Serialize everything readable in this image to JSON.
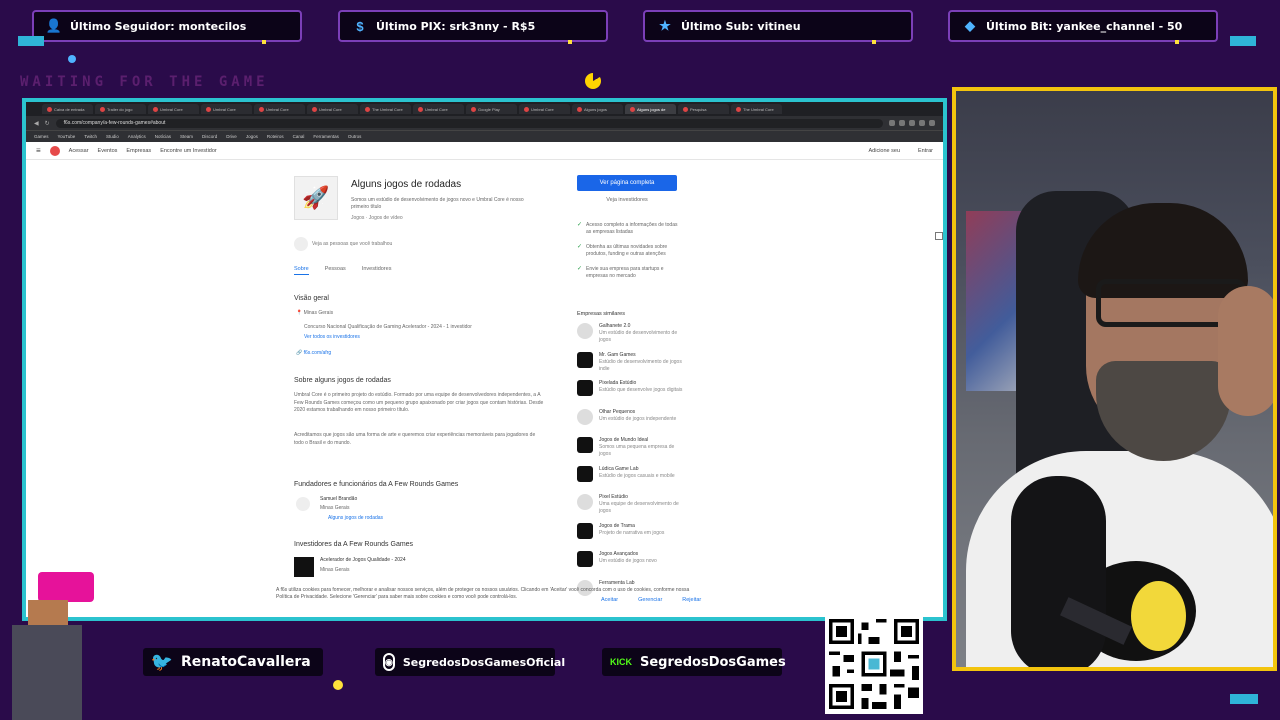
{
  "alerts": [
    {
      "icon": "user-icon",
      "label": "Último Seguidor: montecilos"
    },
    {
      "icon": "dollar-icon",
      "label": "Último PIX: srk3nny - R$5"
    },
    {
      "icon": "star-icon",
      "label": "Último Sub: vitineu"
    },
    {
      "icon": "diamond-icon",
      "label": "Último Bit: yankee_channel - 50"
    }
  ],
  "overlay": {
    "waiting_text": "WAITING FOR THE GAME"
  },
  "browser": {
    "tabs": [
      "Caixa de entrada",
      "Trailer do jogo",
      "Umbral Core",
      "Umbral Core",
      "Umbral Core",
      "Umbral Core",
      "The Umbral Core",
      "Umbral Core",
      "Google Play",
      "Umbral Core",
      "Alguns jogos",
      "Alguns jogos de",
      "Pesquisa",
      "The Umbral Core"
    ],
    "active_tab_index": 11,
    "url": "f6s.com/company/a-few-rounds-games#about",
    "bookmarks": [
      "Games",
      "YouTube",
      "Twitch",
      "Studio",
      "Analytics",
      "Notícias",
      "Steam",
      "Discord",
      "Drive",
      "Jogos",
      "Roteiros",
      "Canal",
      "Ferramentas",
      "Outros"
    ]
  },
  "site": {
    "nav": [
      "Acessar",
      "Eventos",
      "Empresas",
      "Encontre um Investidor"
    ],
    "nav_right": [
      "Adicione seu",
      "Entrar"
    ],
    "company_title": "Alguns jogos de rodadas",
    "company_desc": "Somos um estúdio de desenvolvimento de jogos novo e Umbral Core é nosso primeiro título",
    "company_meta": "Jogos · Jogos de vídeo",
    "follow_text": "Veja as pessoas que você trabalhou",
    "subtabs": [
      "Sobre",
      "Pessoas",
      "Investidores"
    ],
    "overview_title": "Visão geral",
    "location": "Minas Gerais",
    "award": "Concurso Nacional Qualificação de Gaming Acelerador - 2024 - 1 investidor",
    "investors_link": "Ver todos os investidores",
    "links": "f6s.com/afrg",
    "about_title": "Sobre alguns jogos de rodadas",
    "about_p1": "Umbral Core é o primeiro projeto do estúdio. Formado por uma equipe de desenvolvedores independentes, a A Few Rounds Games começou como um pequeno grupo apaixonado por criar jogos que contam histórias. Desde 2020 estamos trabalhando em nosso primeiro título.",
    "about_p2": "Acreditamos que jogos são uma forma de arte e queremos criar experiências memoráveis para jogadores de todo o Brasil e do mundo.",
    "founders_title": "Fundadores e funcionários da A Few Rounds Games",
    "founder_name": "Samuel Brandão",
    "founder_role": "Minas Gerais",
    "founder_link": "Alguns jogos de rodadas",
    "investors_title": "Investidores da A Few Rounds Games",
    "investor_name": "Acelerador de Jogos Qualidade - 2024",
    "investor_loc": "Minas Gerais",
    "cta_button": "Ver página completa",
    "cta_link": "Veja investidores",
    "checks": [
      "Acesso completo a informações de todas as empresas listadas",
      "Obtenha as últimas novidades sobre produtos, funding e outras atenções",
      "Envie sua empresa para startups e empresas no mercado"
    ],
    "similar_title": "Empresas similares",
    "similar": [
      {
        "name": "Galhanete 2.0",
        "desc": "Um estúdio de desenvolvimento de jogos"
      },
      {
        "name": "Mr. Gam Games",
        "desc": "Estúdio de desenvolvimento de jogos indie"
      },
      {
        "name": "Pixelada Estúdio",
        "desc": "Estúdio que desenvolve jogos digitais"
      },
      {
        "name": "Olhar Pequenos",
        "desc": "Um estúdio de jogos independente"
      },
      {
        "name": "Jogos de Mundo Ideal",
        "desc": "Somos uma pequena empresa de jogos"
      },
      {
        "name": "Lúdica Game Lab",
        "desc": "Estúdio de jogos casuais e mobile"
      },
      {
        "name": "Pixel Estúdio",
        "desc": "Uma equipe de desenvolvimento de jogos"
      },
      {
        "name": "Jogos de Trama",
        "desc": "Projeto de narrativa em jogos"
      },
      {
        "name": "Jogos Avançados",
        "desc": "Um estúdio de jogos novo"
      },
      {
        "name": "Ferramenta Lab",
        "desc": ""
      }
    ],
    "cookie_text": "A f6s utiliza cookies para fornecer, melhorar e analisar nossos serviços, além de proteger os nossos usuários. Clicando em 'Aceitar' você concorda com o uso de cookies, conforme nossa Política de Privacidade. Selecione 'Gerenciar' para saber mais sobre cookies e como você pode controlá-los.",
    "cookie_buttons": [
      "Aceitar",
      "Gerenciar",
      "Rejeitar"
    ]
  },
  "socials": [
    {
      "icon": "twitter-icon",
      "label": "RenatoCavallera"
    },
    {
      "icon": "instagram-icon",
      "label": "SegredosDosGamesOficial"
    },
    {
      "icon": "kick-icon",
      "label": "SegredosDosGames"
    }
  ],
  "qr": {
    "label": "livepix.gg/segredosdosgames"
  },
  "colors": {
    "frame": "#2bc3cf",
    "cam_border": "#f3c40e",
    "background": "#2a0b4a",
    "accent_blue": "#1a66e8"
  }
}
